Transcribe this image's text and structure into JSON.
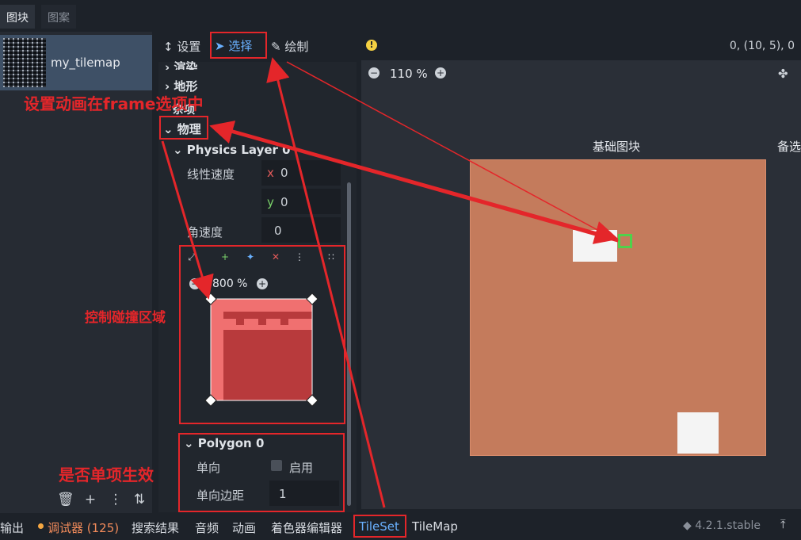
{
  "top_tabs": [
    "图块",
    "图案"
  ],
  "tile_list": [
    {
      "name": "my_tilemap"
    }
  ],
  "mode_toolbar": {
    "setup": "设置",
    "select": "选择",
    "paint": "绘制"
  },
  "coords": "0, (10, 5), 0",
  "inspector": {
    "sections": [
      "渲染",
      "地形",
      "杂项"
    ],
    "physics": "物理",
    "physics_layer": "Physics Layer 0",
    "linear_velocity": "线性速度",
    "lv_x_axis": "x",
    "lv_x": "0",
    "lv_y_axis": "y",
    "lv_y": "0",
    "angular_velocity": "角速度",
    "av": "0",
    "collision_zoom": "800 %",
    "polygon": "Polygon 0",
    "one_way": "单向",
    "one_way_enabled": "启用",
    "one_way_margin": "单向边距",
    "one_way_margin_value": "1"
  },
  "atlas": {
    "zoom": "110 %",
    "base_tiles": "基础图块",
    "alt_tiles": "备选"
  },
  "bottom_tabs": [
    "输出",
    "调试器 (125)",
    "搜索结果",
    "音频",
    "动画",
    "着色器编辑器",
    "TileSet",
    "TileMap"
  ],
  "version": "4.2.1.stable",
  "annotations": {
    "frame": "设置动画在frame选项中",
    "collision": "控制碰撞区域",
    "oneway": "是否单项生效"
  },
  "colors": {
    "accent": "#6ab1ff",
    "annotation": "#e4262a",
    "collision_fill": "#b83a3c",
    "selected": "#4fd14b"
  }
}
